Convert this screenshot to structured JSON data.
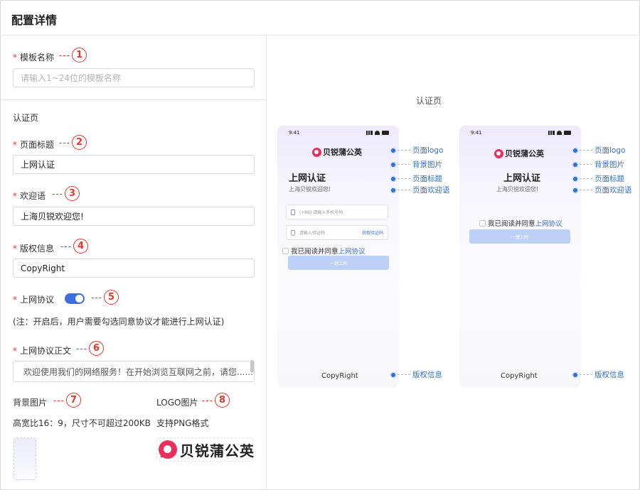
{
  "header": {
    "title": "配置详情"
  },
  "form": {
    "template_name": {
      "label": "模板名称",
      "placeholder": "请输入1~24位的模板名称",
      "marker": "1"
    },
    "section_title": "认证页",
    "page_title": {
      "label": "页面标题",
      "value": "上网认证",
      "marker": "2"
    },
    "welcome": {
      "label": "欢迎语",
      "value": "上海贝锐欢迎您!",
      "marker": "3"
    },
    "copyright": {
      "label": "版权信息",
      "value": "CopyRight",
      "marker": "4"
    },
    "protocol": {
      "label": "上网协议",
      "enabled": true,
      "marker": "5",
      "note": "(注：开启后，用户需要勾选同意协议才能进行上网认证)"
    },
    "protocol_text": {
      "label": "上网协议正文",
      "value": "欢迎使用我们的网络服务！在开始浏览互联网之前，请您......",
      "marker": "6"
    },
    "bg_image": {
      "label": "背景图片",
      "marker": "7",
      "hint": "高宽比16：9，尺寸不可超过200KB"
    },
    "logo_image": {
      "label": "LOGO图片",
      "marker": "8",
      "hint": "支持PNG格式",
      "logo_text": "贝锐蒲公英"
    },
    "required_mark": "*",
    "dashes": "---"
  },
  "preview": {
    "title": "认证页",
    "phone_time": "9:41",
    "logo_text": "贝锐蒲公英",
    "page_title": "上网认证",
    "welcome": "上海贝锐欢迎您!",
    "phone_placeholder": "(+86) 请输入手机号码",
    "code_placeholder": "请输入验证码",
    "get_code": "获取验证码",
    "agree_prefix": "我已阅读并同意",
    "agree_link": "上网协议",
    "connect_button": "一键上网",
    "copyright": "CopyRight",
    "callouts": {
      "logo": "页面logo",
      "bg": "背景图片",
      "title": "页面标题",
      "welcome": "页面欢迎语",
      "copyright": "版权信息"
    }
  },
  "colors": {
    "accent": "#3b6fe0",
    "marker": "#e8352b",
    "callout": "#2f6fd6",
    "logo": "#ea2f5d"
  }
}
